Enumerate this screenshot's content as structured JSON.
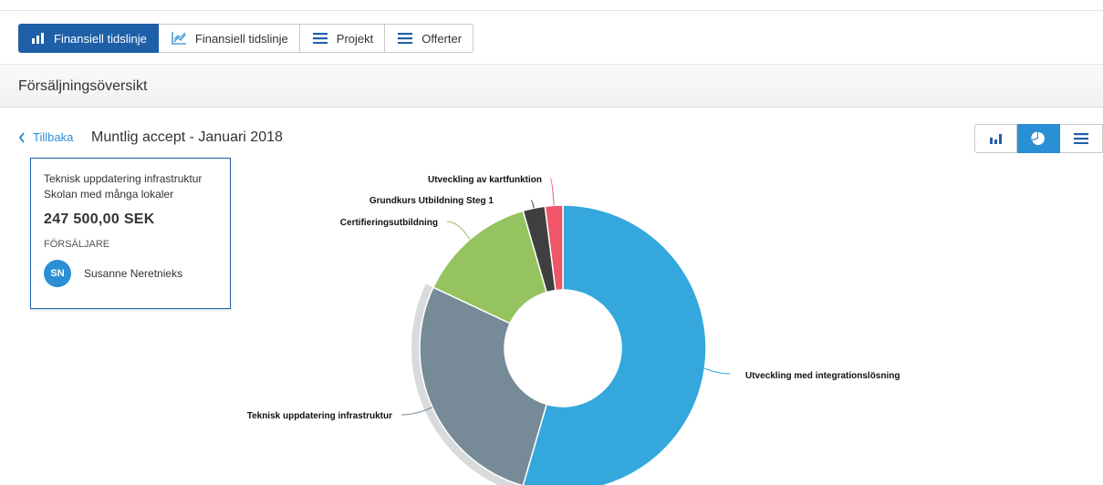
{
  "tabs": [
    {
      "label": "Finansiell tidslinje",
      "icon": "bar-chart-icon",
      "active": true
    },
    {
      "label": "Finansiell tidslinje",
      "icon": "line-chart-icon",
      "active": false
    },
    {
      "label": "Projekt",
      "icon": "list-icon",
      "active": false
    },
    {
      "label": "Offerter",
      "icon": "list-icon",
      "active": false
    }
  ],
  "section": {
    "title": "Försäljningsöversikt"
  },
  "nav": {
    "back_label": "Tillbaka",
    "title": "Muntlig accept - Januari 2018"
  },
  "view_toggle": [
    {
      "icon": "bar-chart-icon",
      "active": false
    },
    {
      "icon": "pie-chart-icon",
      "active": true
    },
    {
      "icon": "list-icon",
      "active": false
    }
  ],
  "info_card": {
    "line1": "Teknisk uppdatering infrastruktur",
    "line2": "Skolan med många lokaler",
    "amount": "247 500,00 SEK",
    "role_label": "FÖRSÄLJARE",
    "seller_initials": "SN",
    "seller_name": "Susanne Neretnieks"
  },
  "colors": {
    "accent": "#1f5fa8",
    "light_accent": "#2b8fd6"
  },
  "chart_data": {
    "type": "pie",
    "donut": true,
    "slices": [
      {
        "label": "Utveckling med integrationslösning",
        "value": 54.5,
        "color": "#34a8dc"
      },
      {
        "label": "Teknisk uppdatering infrastruktur",
        "value": 27.5,
        "color": "#768a97"
      },
      {
        "label": "Certifieringsutbildning",
        "value": 13.5,
        "color": "#95c35f"
      },
      {
        "label": "Grundkurs Utbildning Steg 1",
        "value": 2.5,
        "color": "#3f3f3f"
      },
      {
        "label": "Utveckling av kartfunktion",
        "value": 2.0,
        "color": "#f0566a"
      }
    ]
  }
}
